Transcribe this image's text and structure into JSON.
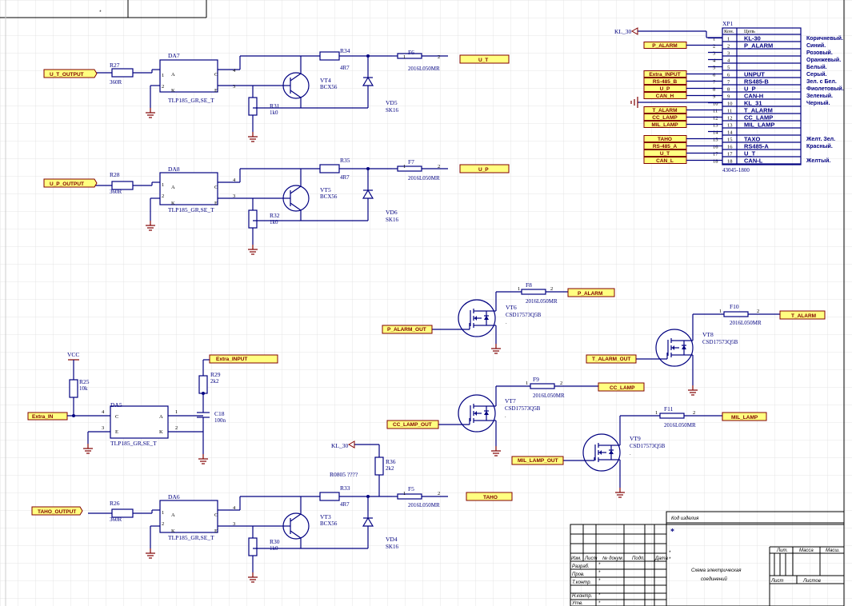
{
  "title_block": {
    "code_header": "Код изделия",
    "code_value": "*",
    "doc_title_1": "Схема электрическая",
    "doc_title_2": "соединений",
    "col_izm": "Изм.",
    "col_list": "Лист",
    "col_ndoc": "№ докум.",
    "col_podp": "Подп.",
    "col_data": "Дата",
    "row_razrab": "Разраб.",
    "row_prov": "Пров.",
    "row_tkontr": "Т.контр.",
    "row_nkontr": "Н.контр.",
    "row_utv": "Утв.",
    "lit": "Лит.",
    "massa": "Масса",
    "masht": "Масш.",
    "list": "Лист",
    "listov": "Листов",
    "star": "*",
    "top_star": "*"
  },
  "connector": {
    "designator": "XP1",
    "part": "43045-1800",
    "col_pin": "Кон.",
    "col_net": "Цепь",
    "pins": [
      "1",
      "2",
      "3",
      "4",
      "5",
      "6",
      "7",
      "8",
      "9",
      "10",
      "11",
      "12",
      "13",
      "14",
      "15",
      "16",
      "17",
      "18"
    ],
    "nets": [
      "KL-30",
      "P_ALARM",
      "",
      "",
      "",
      "UNPUT",
      "RS485-B",
      "U_P",
      "CAN-H",
      "KL_31",
      "T_ALARM",
      "CC_LAMP",
      "MIL_LAMP",
      "",
      "TAXO",
      "RS485-A",
      "U_T",
      "CAN-L"
    ],
    "wire_colors": [
      {
        "pin": 1,
        "text": "Коричневый."
      },
      {
        "pin": 2,
        "text": "Синий."
      },
      {
        "pin": 3,
        "text": "Розовый."
      },
      {
        "pin": 4,
        "text": "Оранжевый."
      },
      {
        "pin": 5,
        "text": "Белый."
      },
      {
        "pin": 6,
        "text": "Серый."
      },
      {
        "pin": 7,
        "text": "Зел. с Бел."
      },
      {
        "pin": 8,
        "text": "Фиолетовый."
      },
      {
        "pin": 9,
        "text": "Зеленый."
      },
      {
        "pin": 10,
        "text": "Черный."
      },
      {
        "pin": 15,
        "text": "Желт. Зел."
      },
      {
        "pin": 16,
        "text": "Красный."
      },
      {
        "pin": 18,
        "text": "Желтый."
      }
    ],
    "ports": [
      {
        "pin": 2,
        "text": "P_ALARM"
      },
      {
        "pin": 6,
        "text": "Extra_INPUT"
      },
      {
        "pin": 7,
        "text": "RS-485_B"
      },
      {
        "pin": 8,
        "text": "U_P"
      },
      {
        "pin": 9,
        "text": "CAN_H"
      },
      {
        "pin": 11,
        "text": "T_ALARM"
      },
      {
        "pin": 12,
        "text": "CC_LAMP"
      },
      {
        "pin": 13,
        "text": "MIL_LAMP"
      },
      {
        "pin": 15,
        "text": "TAHO"
      },
      {
        "pin": 16,
        "text": "RS-485_A"
      },
      {
        "pin": 17,
        "text": "U_T"
      },
      {
        "pin": 18,
        "text": "CAN_L"
      }
    ],
    "kl30": "KL_30"
  },
  "channels": [
    {
      "id": "ut",
      "in_port": "U_T_OUTPUT",
      "r_in": "R27",
      "r_in_val": "360R",
      "da": "DA7",
      "da_part": "TLP185_GR,SE_T",
      "r_b": "R31",
      "r_b_val": "1k0",
      "r_s": "R34",
      "r_s_val": "4R7",
      "vt": "VT4",
      "vt_part": "BCX56",
      "fuse": "F6",
      "fuse_part": "2016L050MR",
      "vd": "VD5",
      "vd_part": "SK16",
      "out_port": "U_T"
    },
    {
      "id": "up",
      "in_port": "U_P_OUTPUT",
      "r_in": "R28",
      "r_in_val": "360R",
      "da": "DA8",
      "da_part": "TLP185_GR,SE_T",
      "r_b": "R32",
      "r_b_val": "1k0",
      "r_s": "R35",
      "r_s_val": "4R7",
      "vt": "VT5",
      "vt_part": "BCX56",
      "fuse": "F7",
      "fuse_part": "2016L050MR",
      "vd": "VD6",
      "vd_part": "SK16",
      "out_port": "U_P"
    },
    {
      "id": "taho",
      "in_port": "TAHO_OUTPUT",
      "r_in": "R26",
      "r_in_val": "360R",
      "da": "DA6",
      "da_part": "TLP185_GR,SE_T",
      "r_b": "R30",
      "r_b_val": "1k0",
      "r_s": "R33",
      "r_s_val": "4R7",
      "vt": "VT3",
      "vt_part": "BCX56",
      "fuse": "F5",
      "fuse_part": "2016L050MR",
      "vd": "VD4",
      "vd_part": "SK16",
      "out_port": "TAHO"
    }
  ],
  "taho_extra": {
    "r36": "R36",
    "r36_val": "2k2",
    "r0805": "R0805 ????",
    "kl30": "KL_30"
  },
  "extra_in": {
    "vcc": "VCC",
    "r25": "R25",
    "r25_val": "10k",
    "in_port": "Extra_IN",
    "da": "DA5",
    "da_part": "TLP185_GR,SE_T",
    "r29": "R29",
    "r29_val": "2k2",
    "c18": "C18",
    "c18_val": "100n",
    "out_port": "Extra_INPUT"
  },
  "pin_labels": {
    "a": "A",
    "k": "K",
    "c": "C",
    "e": "E",
    "p1": "1",
    "p2": "2",
    "p3": "3",
    "p4": "4",
    "dot": "."
  },
  "mosfets": [
    {
      "id": "vt6",
      "in_port": "P_ALARM_OUT",
      "vt": "VT6",
      "part": "CSD17573Q5B",
      "fuse": "F8",
      "fuse_part": "2016L050MR",
      "out_port": "P_ALARM"
    },
    {
      "id": "vt7",
      "in_port": "CC_LAMP_OUT",
      "vt": "VT7",
      "part": "CSD17573Q5B",
      "fuse": "F9",
      "fuse_part": "2016L050MR",
      "out_port": "CC_LAMP"
    },
    {
      "id": "vt8",
      "in_port": "T_ALARM_OUT",
      "vt": "VT8",
      "part": "CSD17573Q5B",
      "fuse": "F10",
      "fuse_part": "2016L050MR",
      "out_port": "T_ALARM"
    },
    {
      "id": "vt9",
      "in_port": "MIL_LAMP_OUT",
      "vt": "VT9",
      "part": "CSD17573Q5B",
      "fuse": "F11",
      "fuse_part": "2016L050MR",
      "out_port": "MIL_LAMP"
    }
  ]
}
